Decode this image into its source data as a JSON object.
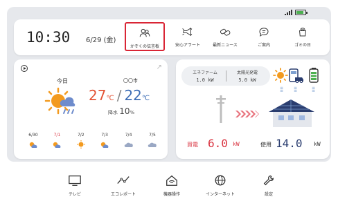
{
  "status": {
    "signal_icon": "signal-icon",
    "battery_icon": "battery-icon"
  },
  "header": {
    "time": "10:30",
    "date": "6/29 (金)",
    "menu": [
      {
        "label": "かぞくの伝言板",
        "icon": "family-icon",
        "selected": true
      },
      {
        "label": "安心アラート",
        "icon": "alert-icon",
        "selected": false
      },
      {
        "label": "最新ニュース",
        "icon": "news-icon",
        "selected": false
      },
      {
        "label": "ご案内",
        "icon": "chat-icon",
        "selected": false
      },
      {
        "label": "ゴミの日",
        "icon": "garbage-icon",
        "selected": false
      }
    ]
  },
  "weather": {
    "today_label": "今日",
    "city": "〇〇市",
    "temp_high": "27",
    "temp_low": "22",
    "temp_unit": "℃",
    "temp_separator": "/",
    "rain_label": "降水",
    "rain_value": "10",
    "rain_unit": "%",
    "colors": {
      "high": "#e35335",
      "low": "#3d6db5"
    },
    "forecast": [
      {
        "date": "6/30",
        "icon": "sun-cloud-icon",
        "red": false
      },
      {
        "date": "7/1",
        "icon": "sun-cloud-icon",
        "red": true
      },
      {
        "date": "7/2",
        "icon": "sun-icon",
        "red": false
      },
      {
        "date": "7/3",
        "icon": "sun-cloud-icon",
        "red": false
      },
      {
        "date": "7/4",
        "icon": "cloud-icon",
        "red": false
      },
      {
        "date": "7/5",
        "icon": "cloud-icon",
        "red": false
      }
    ]
  },
  "energy": {
    "ene_farm_label": "エネファーム",
    "ene_farm_value": "1.0 kW",
    "solar_label": "太陽光発電",
    "solar_value": "5.0 kW",
    "buy_label": "買電",
    "buy_value": "6.0",
    "buy_unit": "kW",
    "use_label": "使用",
    "use_value": "14.0",
    "use_unit": "kW",
    "colors": {
      "buy": "#d9323f",
      "use": "#2a3d6f"
    }
  },
  "nav": [
    {
      "label": "テレビ",
      "icon": "tv-icon"
    },
    {
      "label": "エコレポート",
      "icon": "graph-icon"
    },
    {
      "label": "機器操作",
      "icon": "home-wifi-icon"
    },
    {
      "label": "インターネット",
      "icon": "globe-icon"
    },
    {
      "label": "設定",
      "icon": "wrench-icon"
    }
  ]
}
